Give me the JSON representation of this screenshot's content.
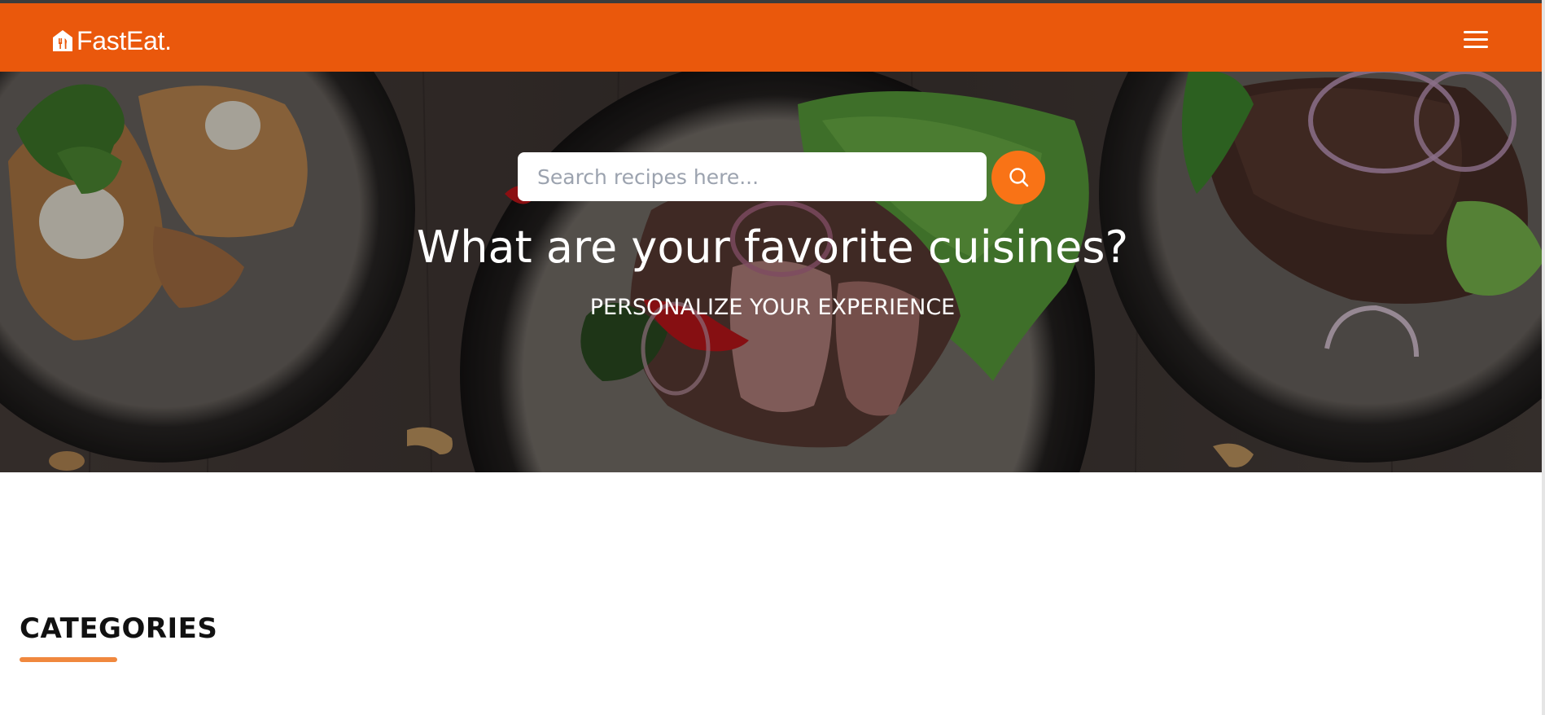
{
  "brand": {
    "name": "FastEat.",
    "icon": "home-utensils-icon"
  },
  "navbar": {
    "menu_icon": "hamburger-menu-icon",
    "color": "#ea580c"
  },
  "search": {
    "placeholder": "Search recipes here...",
    "value": "",
    "button_icon": "search-icon",
    "button_color": "#f97316"
  },
  "hero": {
    "title": "What are your favorite cuisines?",
    "subtitle": "PERSONALIZE YOUR EXPERIENCE"
  },
  "categories": {
    "heading": "CATEGORIES",
    "underline_color": "#f0883e"
  }
}
